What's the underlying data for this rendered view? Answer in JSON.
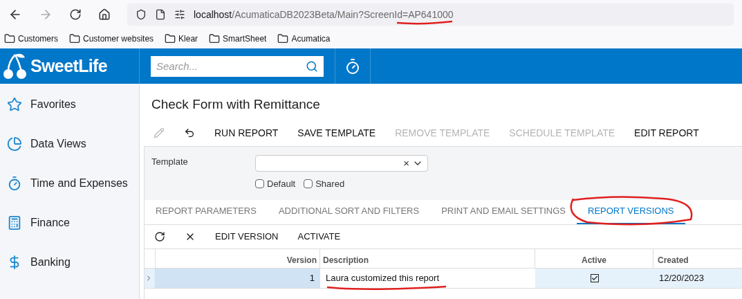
{
  "browser": {
    "url_host": "localhost",
    "url_path": "/AcumaticaDB2023Beta/Main?ScreenId=AP641000",
    "bookmarks": [
      "Customers",
      "Customer websites",
      "Klear",
      "SmartSheet",
      "Acumatica"
    ]
  },
  "header": {
    "logo": "SweetLife",
    "search": {
      "placeholder": "Search..."
    }
  },
  "sidebar": {
    "items": [
      {
        "label": "Favorites",
        "kind": "star"
      },
      {
        "label": "Data Views",
        "kind": "pie"
      },
      {
        "label": "Time and Expenses",
        "kind": "timer"
      },
      {
        "label": "Finance",
        "kind": "calculator"
      },
      {
        "label": "Banking",
        "kind": "dollar"
      }
    ]
  },
  "page": {
    "title": "Check Form with Remittance",
    "toolbar": [
      {
        "label": "RUN REPORT",
        "disabled": false
      },
      {
        "label": "SAVE TEMPLATE",
        "disabled": false
      },
      {
        "label": "REMOVE TEMPLATE",
        "disabled": true
      },
      {
        "label": "SCHEDULE TEMPLATE",
        "disabled": true
      },
      {
        "label": "EDIT REPORT",
        "disabled": false
      }
    ],
    "template": {
      "label": "Template",
      "clear": "×",
      "checkboxes": [
        {
          "label": "Default",
          "checked": false
        },
        {
          "label": "Shared",
          "checked": false
        }
      ]
    },
    "tabs": [
      {
        "label": "REPORT PARAMETERS",
        "selected": false
      },
      {
        "label": "ADDITIONAL SORT AND FILTERS",
        "selected": false
      },
      {
        "label": "PRINT AND EMAIL SETTINGS",
        "selected": false
      },
      {
        "label": "REPORT VERSIONS",
        "selected": true
      }
    ],
    "grid_toolbar": [
      "EDIT VERSION",
      "ACTIVATE"
    ],
    "table": {
      "columns": [
        "Version",
        "Description",
        "Active",
        "Created"
      ],
      "rows": [
        {
          "version": "1",
          "description": "Laura customized this report",
          "active": true,
          "created": "12/20/2023",
          "selected": true
        }
      ]
    }
  }
}
